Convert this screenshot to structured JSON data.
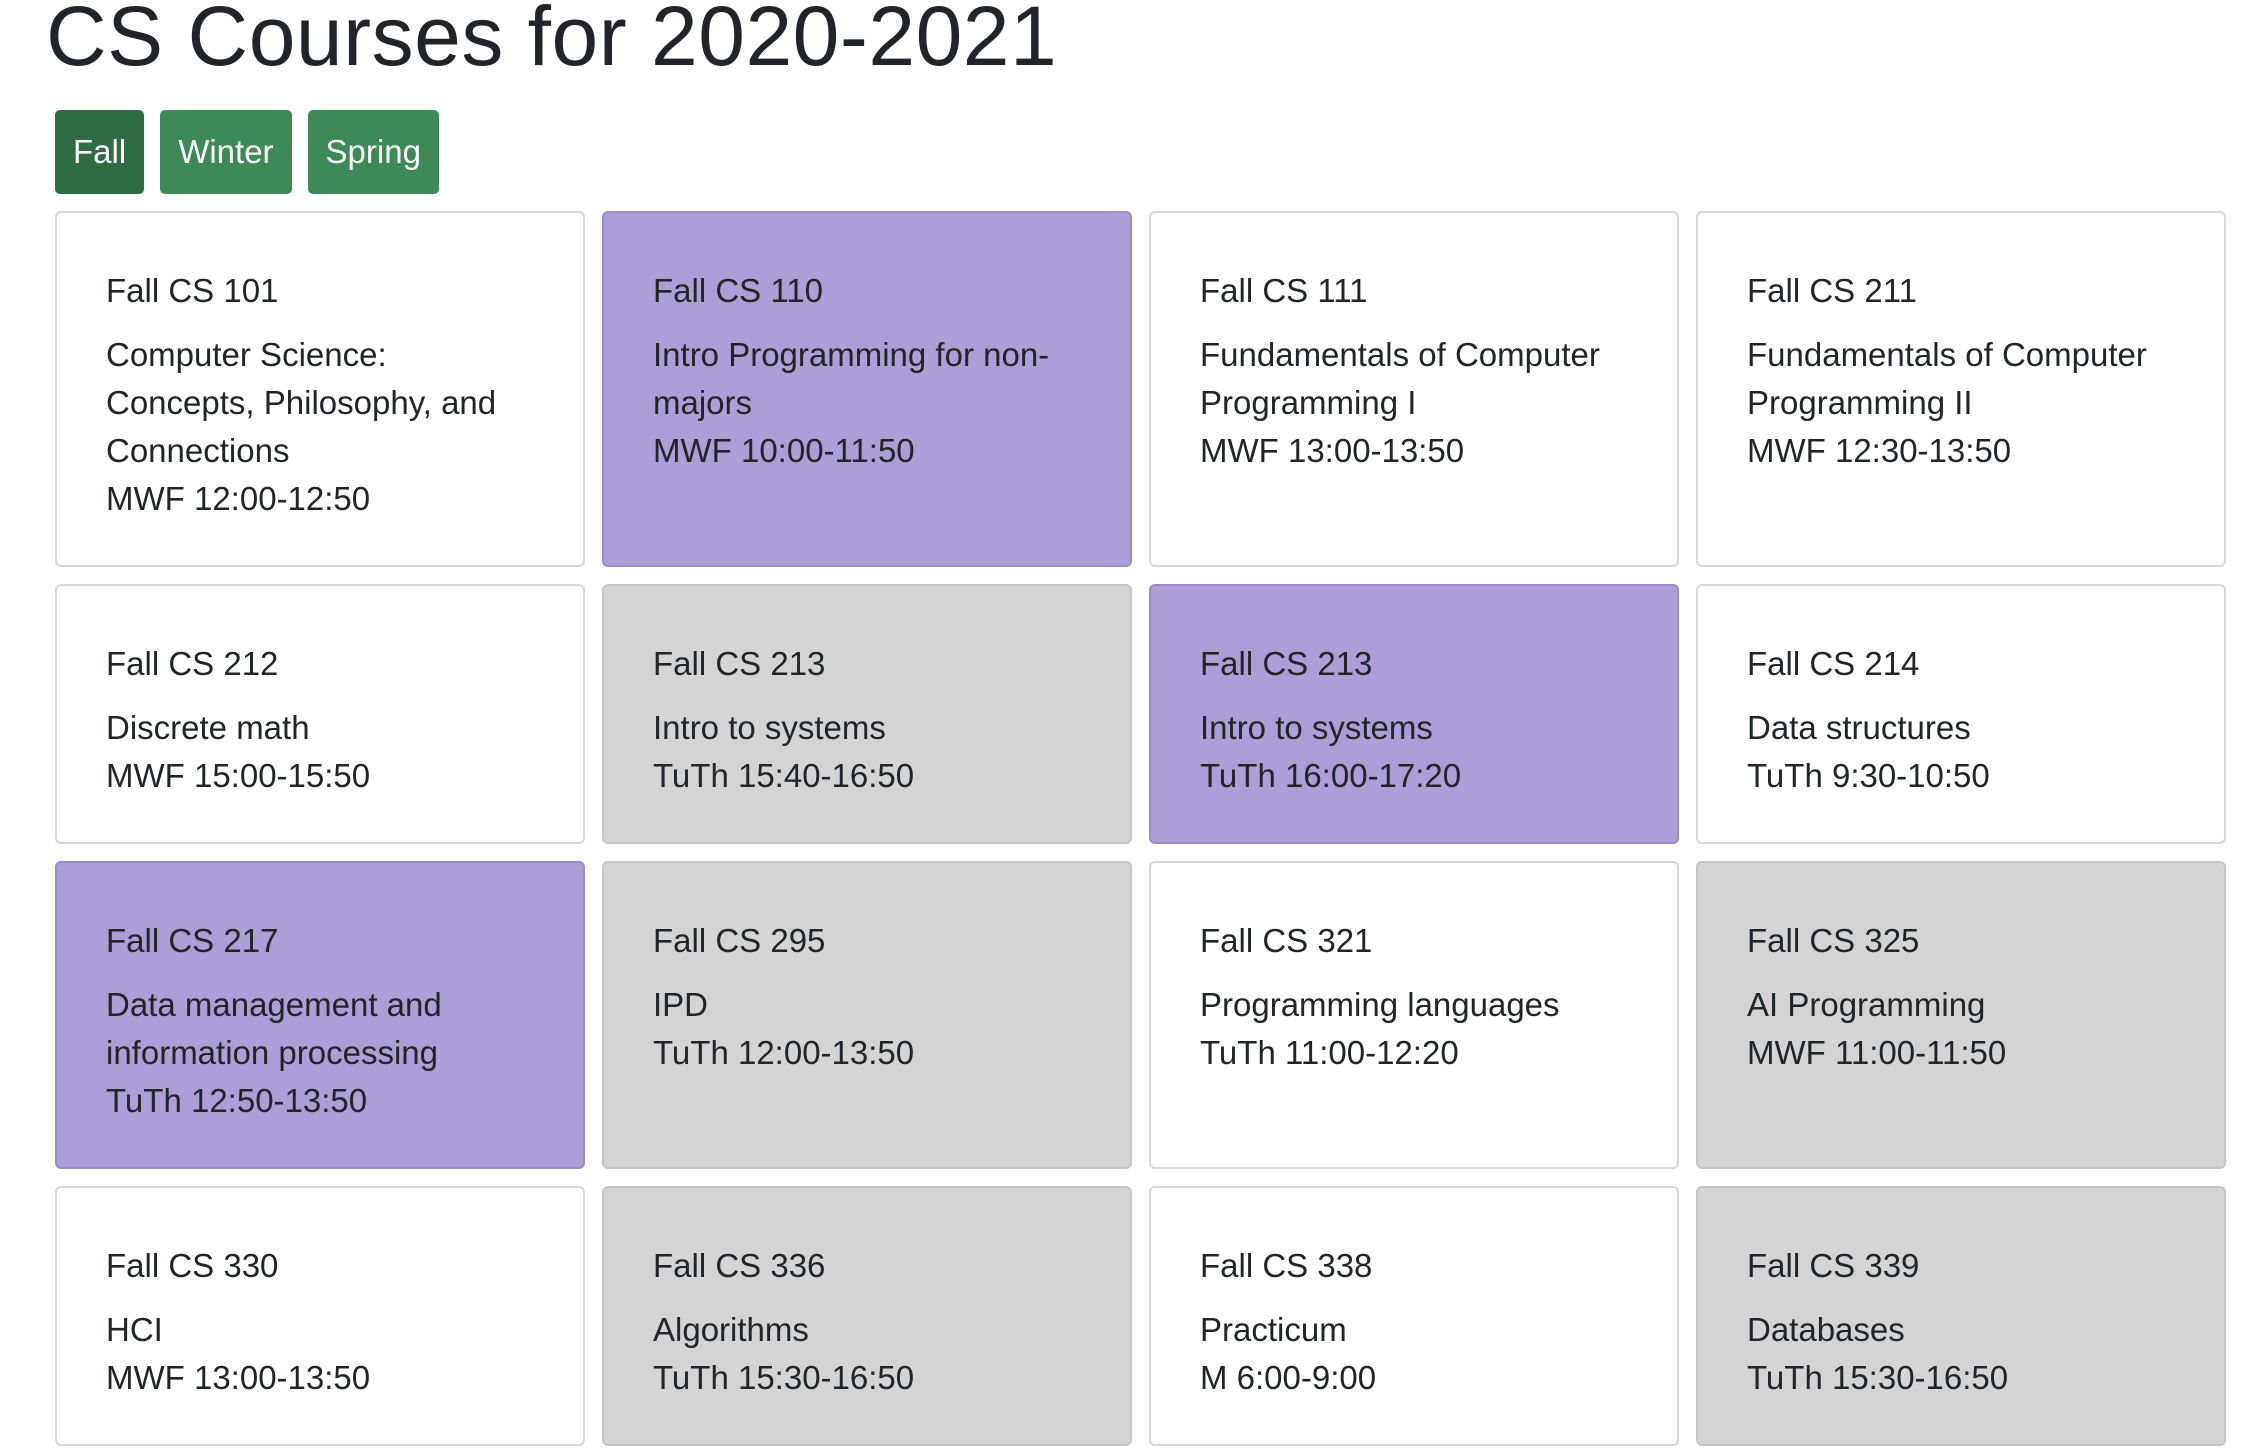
{
  "page": {
    "title": "CS Courses for 2020-2021"
  },
  "terms": [
    {
      "label": "Fall",
      "active": true
    },
    {
      "label": "Winter",
      "active": false
    },
    {
      "label": "Spring",
      "active": false
    }
  ],
  "colors": {
    "term_button": "#3d8a57",
    "term_button_active": "#2f6b44",
    "card_default": "#ffffff",
    "card_gray": "#d4d4d4",
    "card_purple": "#ac9ed6"
  },
  "courses": [
    {
      "code": "Fall CS 101",
      "name": "Computer Science: Concepts, Philosophy, and Connections",
      "time": "MWF 12:00-12:50",
      "status": "default"
    },
    {
      "code": "Fall CS 110",
      "name": "Intro Programming for non-majors",
      "time": "MWF 10:00-11:50",
      "status": "purple"
    },
    {
      "code": "Fall CS 111",
      "name": "Fundamentals of Computer Programming I",
      "time": "MWF 13:00-13:50",
      "status": "default"
    },
    {
      "code": "Fall CS 211",
      "name": "Fundamentals of Computer Programming II",
      "time": "MWF 12:30-13:50",
      "status": "default"
    },
    {
      "code": "Fall CS 212",
      "name": "Discrete math",
      "time": "MWF 15:00-15:50",
      "status": "default"
    },
    {
      "code": "Fall CS 213",
      "name": "Intro to systems",
      "time": "TuTh 15:40-16:50",
      "status": "gray"
    },
    {
      "code": "Fall CS 213",
      "name": "Intro to systems",
      "time": "TuTh 16:00-17:20",
      "status": "purple"
    },
    {
      "code": "Fall CS 214",
      "name": "Data structures",
      "time": "TuTh 9:30-10:50",
      "status": "default"
    },
    {
      "code": "Fall CS 217",
      "name": "Data management and information processing",
      "time": "TuTh 12:50-13:50",
      "status": "purple"
    },
    {
      "code": "Fall CS 295",
      "name": "IPD",
      "time": "TuTh 12:00-13:50",
      "status": "gray"
    },
    {
      "code": "Fall CS 321",
      "name": "Programming languages",
      "time": "TuTh 11:00-12:20",
      "status": "default"
    },
    {
      "code": "Fall CS 325",
      "name": "AI Programming",
      "time": "MWF 11:00-11:50",
      "status": "gray"
    },
    {
      "code": "Fall CS 330",
      "name": "HCI",
      "time": "MWF 13:00-13:50",
      "status": "default"
    },
    {
      "code": "Fall CS 336",
      "name": "Algorithms",
      "time": "TuTh 15:30-16:50",
      "status": "gray"
    },
    {
      "code": "Fall CS 338",
      "name": "Practicum",
      "time": "M 6:00-9:00",
      "status": "default"
    },
    {
      "code": "Fall CS 339",
      "name": "Databases",
      "time": "TuTh 15:30-16:50",
      "status": "gray"
    }
  ]
}
